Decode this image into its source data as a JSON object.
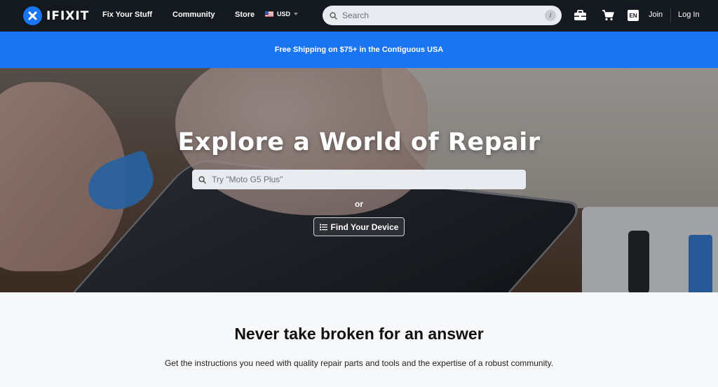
{
  "nav": {
    "brand": "IFIXIT",
    "links": [
      "Fix Your Stuff",
      "Community",
      "Store"
    ],
    "currency": "USD",
    "search_placeholder": "Search",
    "search_shortcut": "/",
    "lang": "EN",
    "join": "Join",
    "login": "Log In"
  },
  "banner": {
    "text": "Free Shipping on $75+ in the Contiguous USA"
  },
  "hero": {
    "title": "Explore a World of Repair",
    "search_placeholder": "Try \"Moto G5 Plus\"",
    "or": "or",
    "find_button": "Find Your Device"
  },
  "intro": {
    "title": "Never take broken for an answer",
    "text": "Get the instructions you need with quality repair parts and tools and the expertise of a robust community."
  },
  "colors": {
    "nav_bg": "#14181f",
    "brand_blue": "#1975f2",
    "page_bg": "#f7f8fa"
  }
}
